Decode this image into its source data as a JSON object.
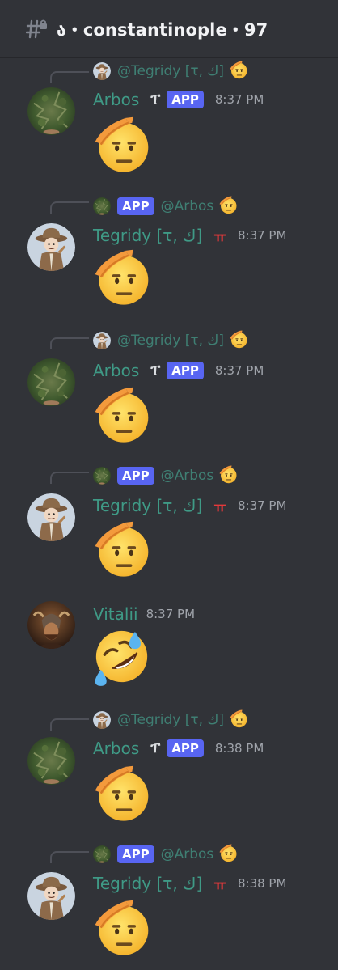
{
  "header": {
    "channel_icon": "hash-lock-icon",
    "channel_name": "ა・constantinople・97"
  },
  "colors": {
    "background": "#313338",
    "username": "#3f9a86",
    "app_badge": "#5865f2",
    "tegridy_tag": "#e5393b"
  },
  "messages": [
    {
      "reply": {
        "name": "@Tegridy [τ, ك]",
        "avatar": "tegridy-avatar",
        "emoji": "saluting-face-icon"
      },
      "author": "Arbos",
      "tag": "ፐ",
      "app": "APP",
      "time": "8:37 PM",
      "avatar": "arbos-avatar",
      "content_emoji": "saluting-face-icon"
    },
    {
      "reply": {
        "app": "APP",
        "name": "@Arbos",
        "avatar": "arbos-avatar",
        "emoji": "saluting-face-icon"
      },
      "author": "Tegridy [τ, ك]",
      "tag": "ㅠ",
      "time": "8:37 PM",
      "avatar": "tegridy-avatar",
      "content_emoji": "saluting-face-icon"
    },
    {
      "reply": {
        "name": "@Tegridy [τ, ك]",
        "avatar": "tegridy-avatar",
        "emoji": "saluting-face-icon"
      },
      "author": "Arbos",
      "tag": "ፐ",
      "app": "APP",
      "time": "8:37 PM",
      "avatar": "arbos-avatar",
      "content_emoji": "saluting-face-icon"
    },
    {
      "reply": {
        "app": "APP",
        "name": "@Arbos",
        "avatar": "arbos-avatar",
        "emoji": "saluting-face-icon"
      },
      "author": "Tegridy [τ, ك]",
      "tag": "ㅠ",
      "time": "8:37 PM",
      "avatar": "tegridy-avatar",
      "content_emoji": "saluting-face-icon"
    },
    {
      "author": "Vitalii",
      "time": "8:37 PM",
      "avatar": "vitalii-avatar",
      "content_emoji": "rolling-on-floor-laughing-icon"
    },
    {
      "reply": {
        "name": "@Tegridy [τ, ك]",
        "avatar": "tegridy-avatar",
        "emoji": "saluting-face-icon"
      },
      "author": "Arbos",
      "tag": "ፐ",
      "app": "APP",
      "time": "8:38 PM",
      "avatar": "arbos-avatar",
      "content_emoji": "saluting-face-icon"
    },
    {
      "reply": {
        "app": "APP",
        "name": "@Arbos",
        "avatar": "arbos-avatar",
        "emoji": "saluting-face-icon"
      },
      "author": "Tegridy [τ, ك]",
      "tag": "ㅠ",
      "time": "8:38 PM",
      "avatar": "tegridy-avatar",
      "content_emoji": "saluting-face-icon"
    }
  ]
}
